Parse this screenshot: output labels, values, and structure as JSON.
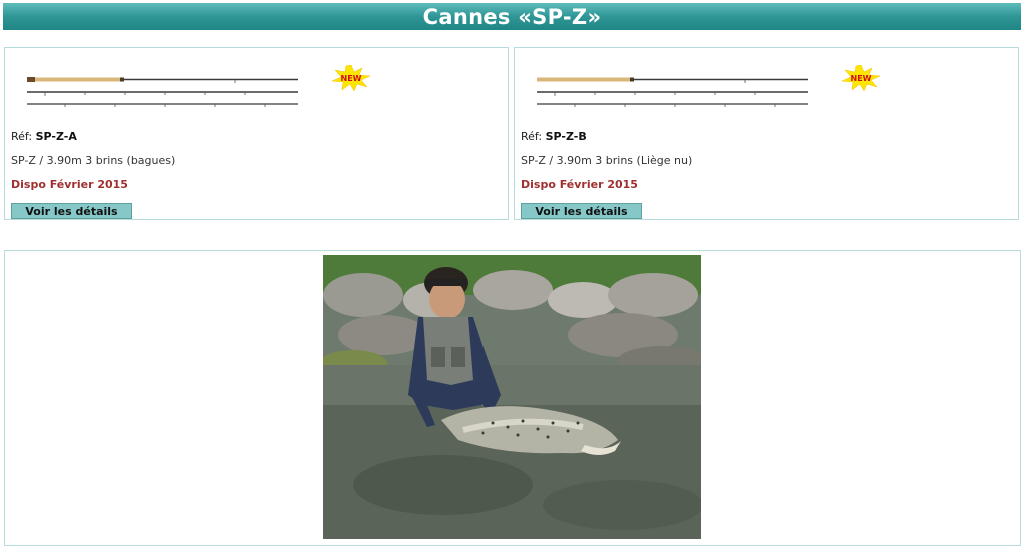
{
  "header": {
    "title": "Cannes «SP-Z»"
  },
  "products": [
    {
      "ref_label": "Réf:",
      "ref_code": "SP-Z-A",
      "description": "SP-Z / 3.90m 3 brins (bagues)",
      "availability": "Dispo Février 2015",
      "button_label": "Voir les détails",
      "badge_text": "NEW"
    },
    {
      "ref_label": "Réf:",
      "ref_code": "SP-Z-B",
      "description": "SP-Z / 3.90m 3 brins (Liège nu)",
      "availability": "Dispo Février 2015",
      "button_label": "Voir les détails",
      "badge_text": "NEW"
    }
  ],
  "colors": {
    "header": "#2f9595",
    "button": "#86c8c8",
    "availability": "#a03030",
    "border": "#b7dcdc"
  }
}
